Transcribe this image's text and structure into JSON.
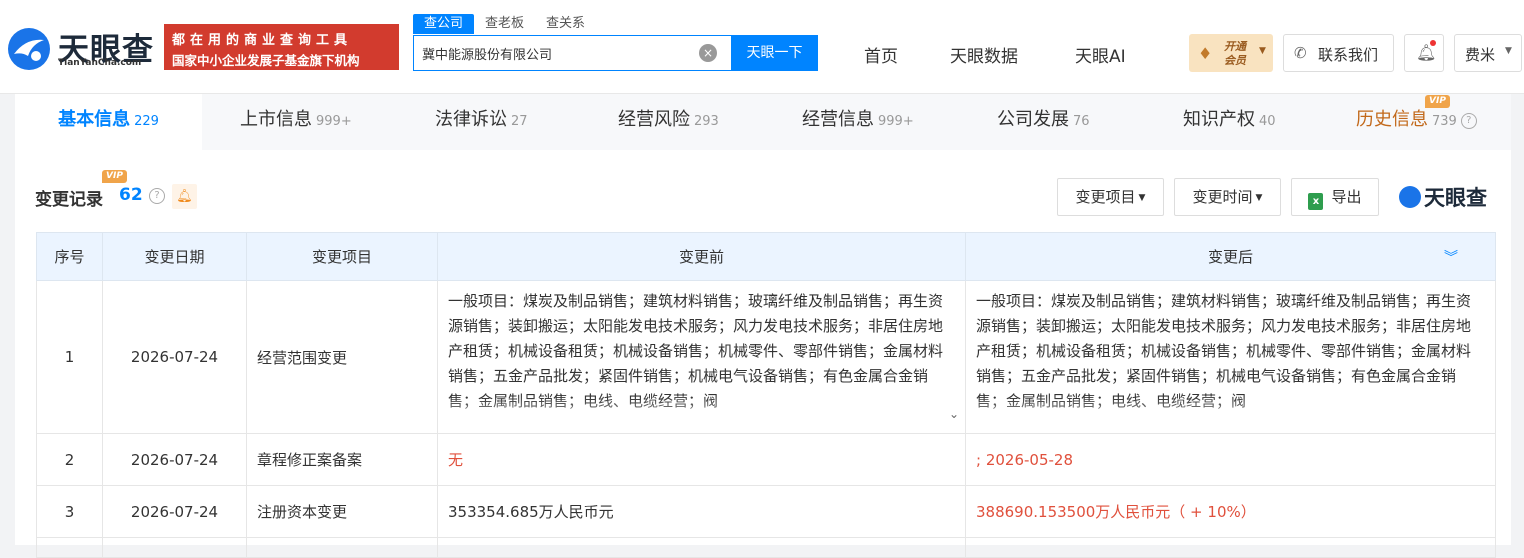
{
  "header": {
    "logo_text": "天眼查",
    "logo_sub": "TianYanCha.com",
    "banner_line1": "都在用的商业查询工具",
    "banner_line2": "国家中小企业发展子基金旗下机构",
    "search_tabs": [
      "查公司",
      "查老板",
      "查关系"
    ],
    "search_value": "冀中能源股份有限公司",
    "search_button": "天眼一下",
    "nav": [
      "首页",
      "天眼数据",
      "天眼AI"
    ],
    "vip_line1": "开通",
    "vip_line2": "会员",
    "contact": "联系我们",
    "user": "费米"
  },
  "main_tabs": [
    {
      "label": "基本信息",
      "count": "229"
    },
    {
      "label": "上市信息",
      "count": "999+"
    },
    {
      "label": "法律诉讼",
      "count": "27"
    },
    {
      "label": "经营风险",
      "count": "293"
    },
    {
      "label": "经营信息",
      "count": "999+"
    },
    {
      "label": "公司发展",
      "count": "76"
    },
    {
      "label": "知识产权",
      "count": "40"
    },
    {
      "label": "历史信息",
      "count": "739"
    }
  ],
  "vip_tag": "VIP",
  "section": {
    "title": "变更记录",
    "count": "62",
    "filter_item": "变更项目",
    "filter_time": "变更时间",
    "export": "导出",
    "brand": "天眼查"
  },
  "table": {
    "headers": [
      "序号",
      "变更日期",
      "变更项目",
      "变更前",
      "变更后"
    ],
    "rows": [
      {
        "no": "1",
        "date": "2026-07-24",
        "item": "经营范围变更",
        "before": "一般项目：煤炭及制品销售；建筑材料销售；玻璃纤维及制品销售；再生资源销售；装卸搬运；太阳能发电技术服务；风力发电技术服务；非居住房地产租赁；机械设备租赁；机械设备销售；机械零件、零部件销售；金属材料销售；五金产品批发；紧固件销售；机械电气设备销售；有色金属合金销售；金属制品销售；电线、电缆经营；阀",
        "after": "一般项目：煤炭及制品销售；建筑材料销售；玻璃纤维及制品销售；再生资源销售；装卸搬运；太阳能发电技术服务；风力发电技术服务；非居住房地产租赁；机械设备租赁；机械设备销售；机械零件、零部件销售；金属材料销售；五金产品批发；紧固件销售；机械电气设备销售；有色金属合金销售；金属制品销售；电线、电缆经营；阀"
      },
      {
        "no": "2",
        "date": "2026-07-24",
        "item": "章程修正案备案",
        "before": "无",
        "after": "; 2026-05-28"
      },
      {
        "no": "3",
        "date": "2026-07-24",
        "item": "注册资本变更",
        "before": "353354.685万人民币元",
        "after": "388690.153500万人民币元（ + 10%）"
      }
    ]
  }
}
